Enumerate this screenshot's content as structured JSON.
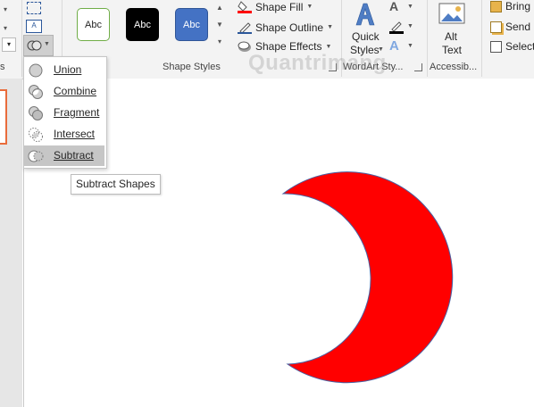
{
  "ribbon": {
    "shape_styles": {
      "label": "Shape Styles",
      "swatches": [
        {
          "text": "Abc",
          "fill": "#ffffff",
          "border": "#70ad47",
          "text_color": "#262626"
        },
        {
          "text": "Abc",
          "fill": "#000000",
          "border": "#000000",
          "text_color": "#ffffff"
        },
        {
          "text": "Abc",
          "fill": "#4472c4",
          "border": "#2f5597",
          "text_color": "#ffffff"
        }
      ],
      "commands": {
        "fill": "Shape Fill",
        "outline": "Shape Outline",
        "effects": "Shape Effects"
      }
    },
    "wordart": {
      "label": "WordArt Sty...",
      "quick_styles_line1": "Quick",
      "quick_styles_line2": "Styles"
    },
    "accessibility": {
      "label": "Accessib...",
      "alt_text_line1": "Alt",
      "alt_text_line2": "Text"
    },
    "arrange": {
      "bring": "Bring",
      "send": "Send",
      "select": "Select"
    },
    "left_group_label_fragment": "s"
  },
  "merge_menu": {
    "items": [
      {
        "label": "Union",
        "selected": false
      },
      {
        "label": "Combine",
        "selected": false
      },
      {
        "label": "Fragment",
        "selected": false
      },
      {
        "label": "Intersect",
        "selected": false
      },
      {
        "label": "Subtract",
        "selected": true
      }
    ]
  },
  "tooltip": "Subtract Shapes",
  "watermark": "Quantrimang",
  "canvas": {
    "shape": "subtract-result-crescent",
    "fill_color": "#ff0000",
    "outline_color": "#4a5fa0"
  },
  "colors": {
    "font_color_bar": "#000000",
    "fill_bar": "#ff0000",
    "selected_accent": "#e96c3b"
  }
}
